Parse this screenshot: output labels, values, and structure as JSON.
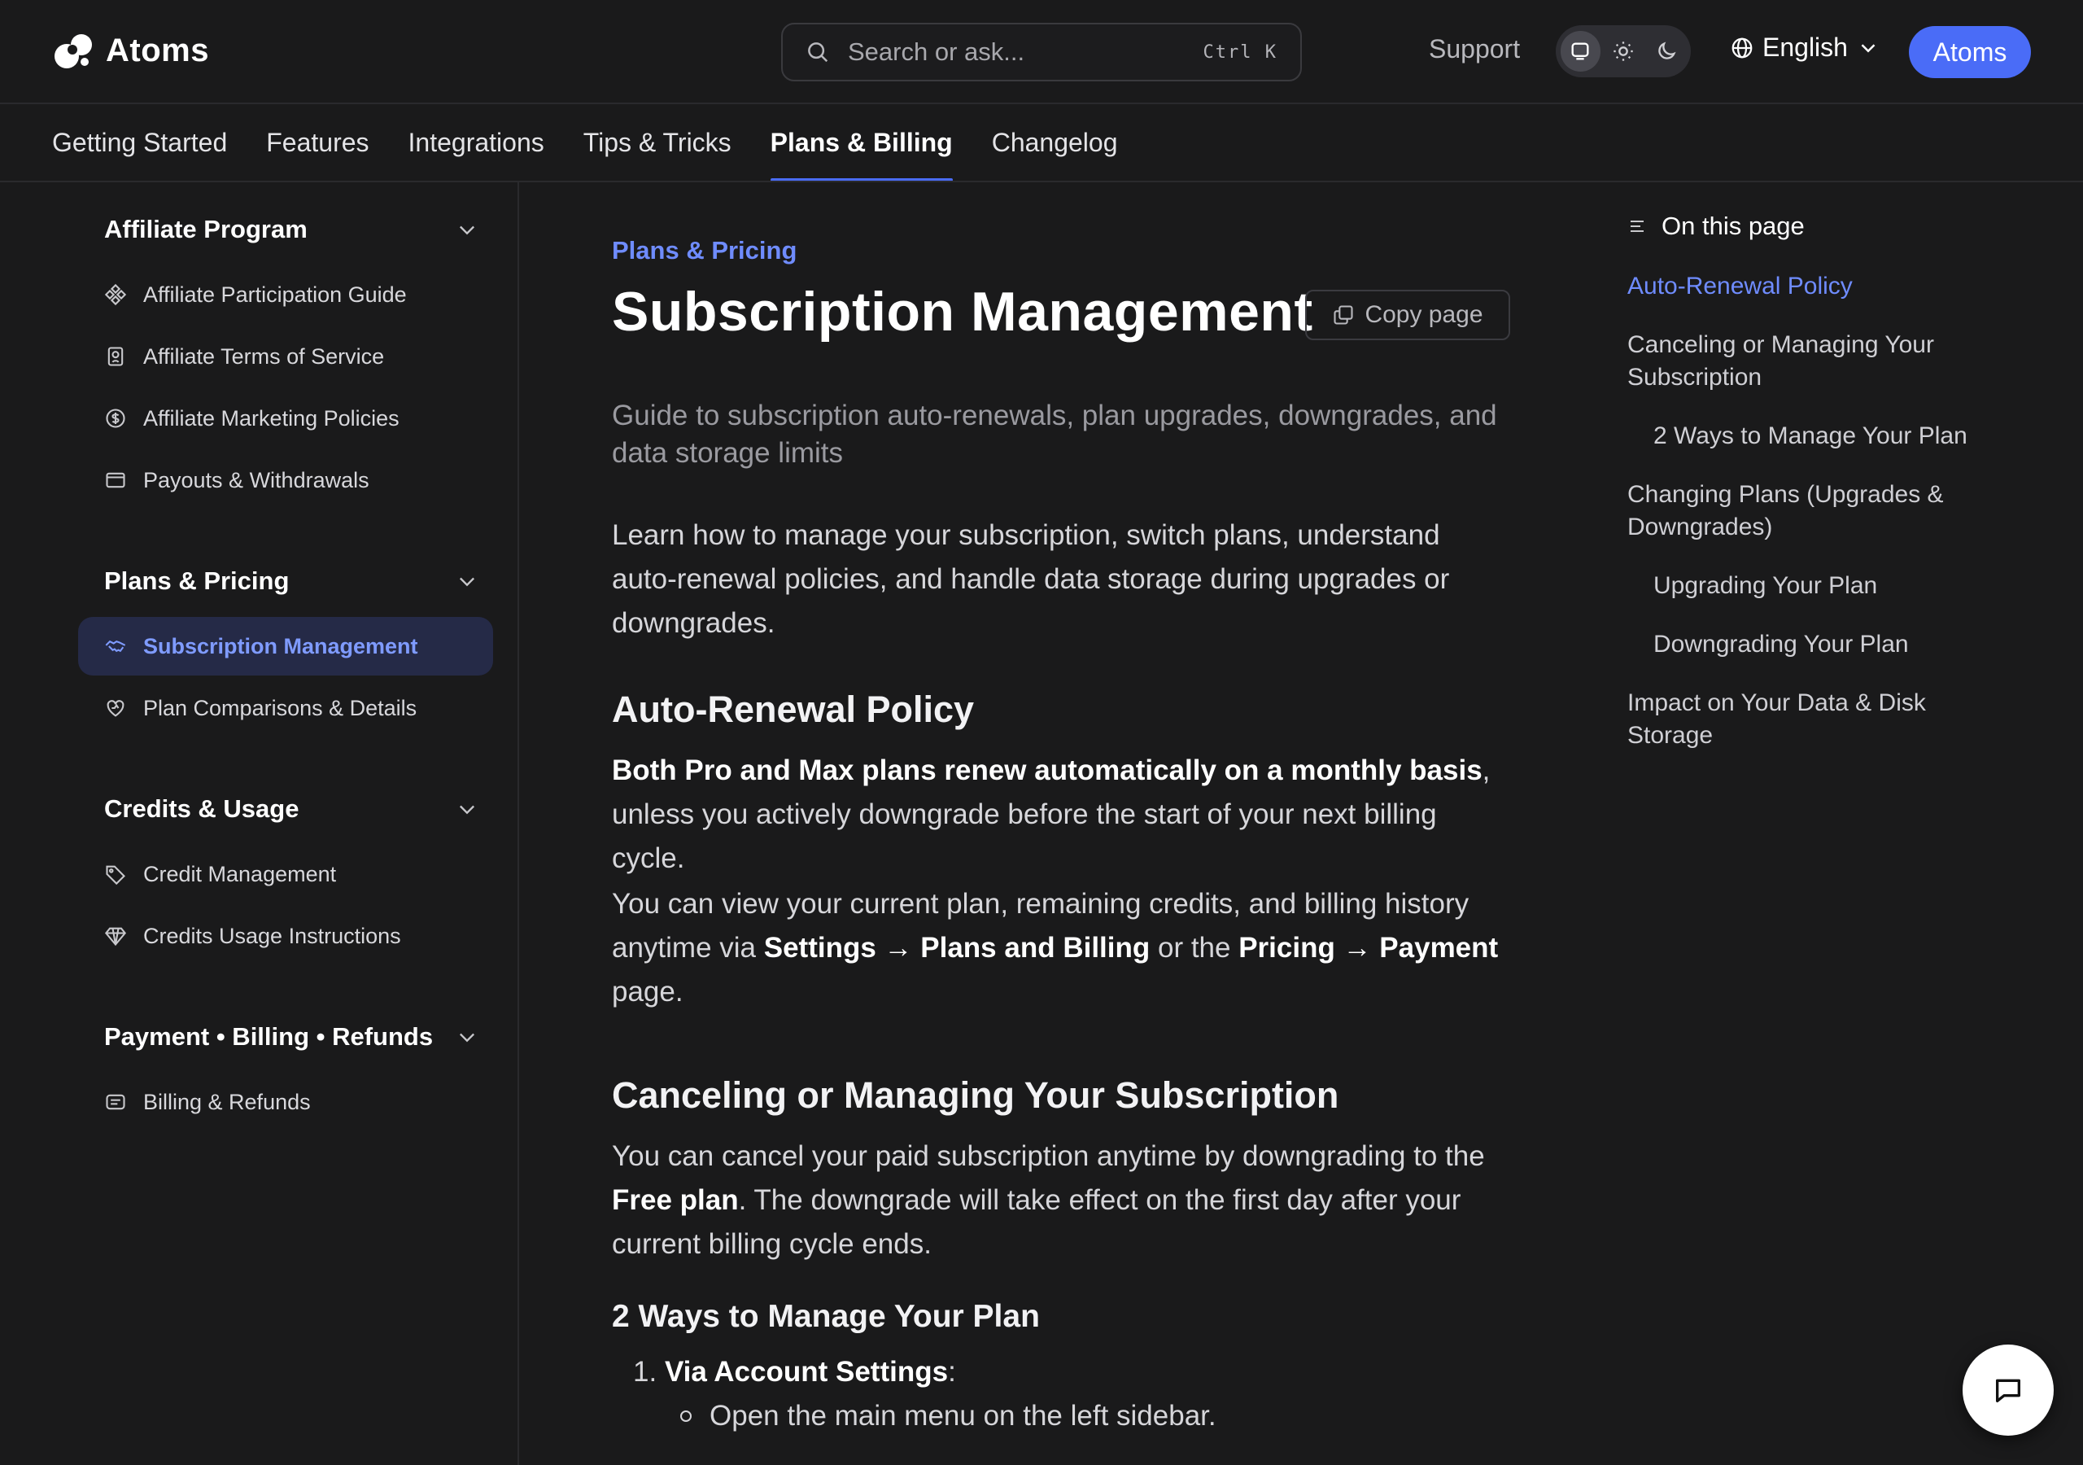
{
  "header": {
    "brand": "Atoms",
    "search_placeholder": "Search or ask...",
    "search_shortcut": "Ctrl K",
    "support": "Support",
    "theme_modes": [
      "system",
      "light",
      "dark"
    ],
    "language": "English",
    "cta": "Atoms",
    "accent_color": "#4a6cf7"
  },
  "tabs": [
    {
      "label": "Getting Started",
      "active": false
    },
    {
      "label": "Features",
      "active": false
    },
    {
      "label": "Integrations",
      "active": false
    },
    {
      "label": "Tips & Tricks",
      "active": false
    },
    {
      "label": "Plans & Billing",
      "active": true
    },
    {
      "label": "Changelog",
      "active": false
    }
  ],
  "sidebar": {
    "groups": [
      {
        "title": "Affiliate Program",
        "items": [
          {
            "label": "Affiliate Participation Guide",
            "icon": "diamond-grid-icon"
          },
          {
            "label": "Affiliate Terms of Service",
            "icon": "badge-document-icon"
          },
          {
            "label": "Affiliate Marketing Policies",
            "icon": "dollar-circle-icon"
          },
          {
            "label": "Payouts & Withdrawals",
            "icon": "wallet-icon"
          }
        ]
      },
      {
        "title": "Plans & Pricing",
        "items": [
          {
            "label": "Subscription Management",
            "icon": "handshake-icon",
            "active": true
          },
          {
            "label": "Plan Comparisons & Details",
            "icon": "heart-shield-icon"
          }
        ]
      },
      {
        "title": "Credits & Usage",
        "items": [
          {
            "label": "Credit Management",
            "icon": "tag-icon"
          },
          {
            "label": "Credits Usage Instructions",
            "icon": "gem-icon"
          }
        ]
      },
      {
        "title": "Payment • Billing • Refunds",
        "items": [
          {
            "label": "Billing & Refunds",
            "icon": "receipt-icon"
          }
        ]
      }
    ]
  },
  "main": {
    "eyebrow": "Plans & Pricing",
    "title": "Subscription Management",
    "copy_button": "Copy page",
    "subtitle": "Guide to subscription auto-renewals, plan upgrades, downgrades, and data storage limits",
    "intro": "Learn how to manage your subscription, switch plans, understand auto-renewal policies, and handle data storage during upgrades or downgrades.",
    "section1": {
      "heading": "Auto-Renewal Policy",
      "p1_bold": "Both Pro and Max plans renew automatically on a monthly basis",
      "p1_rest": ", unless you actively downgrade before the start of your next billing cycle.",
      "p2_a": "You can view your current plan, remaining credits, and billing history anytime via ",
      "p2_b1": "Settings → Plans and Billing",
      "p2_c": " or the ",
      "p2_b2": "Pricing → Payment",
      "p2_d": " page."
    },
    "section2": {
      "heading": "Canceling or Managing Your Subscription",
      "p_a": "You can cancel your paid subscription anytime by downgrading to the ",
      "p_bold": "Free plan",
      "p_b": ". The downgrade will take effect on the first day after your current billing cycle ends.",
      "subheading": "2 Ways to Manage Your Plan",
      "ol1_num": "1.",
      "ol1_bold": "Via Account Settings",
      "ol1_colon": ":",
      "li1": "Open the main menu on the left sidebar."
    }
  },
  "toc": {
    "title": "On this page",
    "links": [
      {
        "label": "Auto-Renewal Policy",
        "level": 1,
        "active": true
      },
      {
        "label": "Canceling or Managing Your Subscription",
        "level": 1
      },
      {
        "label": "2 Ways to Manage Your Plan",
        "level": 2
      },
      {
        "label": "Changing Plans (Upgrades & Downgrades)",
        "level": 1
      },
      {
        "label": "Upgrading Your Plan",
        "level": 2
      },
      {
        "label": "Downgrading Your Plan",
        "level": 2
      },
      {
        "label": "Impact on Your Data & Disk Storage",
        "level": 1
      }
    ]
  },
  "chat": {
    "icon": "chat-bubble-icon"
  }
}
